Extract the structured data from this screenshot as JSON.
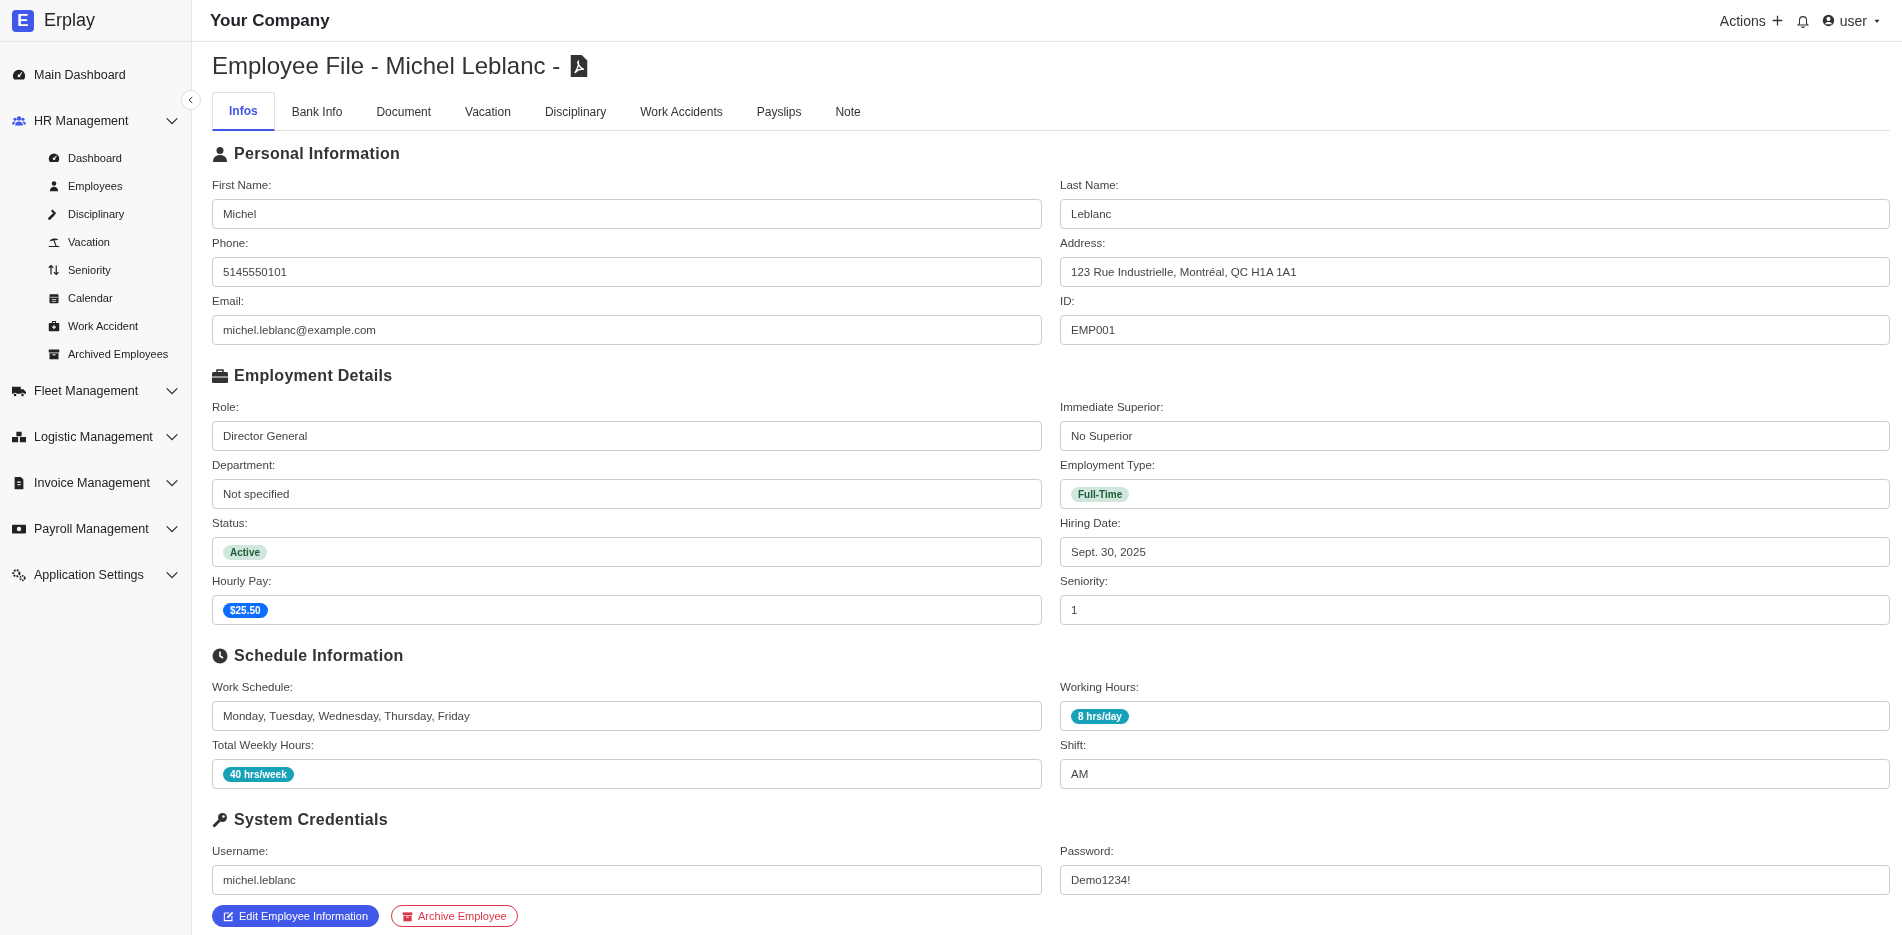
{
  "brand": {
    "logo_letter": "E",
    "name": "Erplay"
  },
  "topbar": {
    "company": "Your Company",
    "actions": "Actions",
    "user": "user"
  },
  "sidebar": {
    "items": [
      {
        "label": "Main Dashboard",
        "selected": false,
        "kind": "link"
      },
      {
        "label": "HR Management",
        "selected": true,
        "kind": "group",
        "children": [
          {
            "label": "Dashboard"
          },
          {
            "label": "Employees"
          },
          {
            "label": "Disciplinary"
          },
          {
            "label": "Vacation"
          },
          {
            "label": "Seniority"
          },
          {
            "label": "Calendar"
          },
          {
            "label": "Work Accident"
          },
          {
            "label": "Archived Employees"
          }
        ]
      },
      {
        "label": "Fleet Management",
        "selected": false,
        "kind": "group"
      },
      {
        "label": "Logistic Management",
        "selected": false,
        "kind": "group"
      },
      {
        "label": "Invoice Management",
        "selected": false,
        "kind": "group"
      },
      {
        "label": "Payroll Management",
        "selected": false,
        "kind": "group"
      },
      {
        "label": "Application Settings",
        "selected": false,
        "kind": "group"
      }
    ]
  },
  "page_title": "Employee File - Michel Leblanc -",
  "tabs": [
    {
      "label": "Infos",
      "selected": true
    },
    {
      "label": "Bank Info",
      "selected": false
    },
    {
      "label": "Document",
      "selected": false
    },
    {
      "label": "Vacation",
      "selected": false
    },
    {
      "label": "Disciplinary",
      "selected": false
    },
    {
      "label": "Work Accidents",
      "selected": false
    },
    {
      "label": "Payslips",
      "selected": false
    },
    {
      "label": "Note",
      "selected": false
    }
  ],
  "sections": [
    {
      "title": "Personal Information",
      "fields": [
        {
          "label": "First Name:",
          "value": "Michel",
          "kind": "text"
        },
        {
          "label": "Last Name:",
          "value": "Leblanc",
          "kind": "text"
        },
        {
          "label": "Phone:",
          "value": "5145550101",
          "kind": "text"
        },
        {
          "label": "Address:",
          "value": "123 Rue Industrielle, Montréal, QC H1A 1A1",
          "kind": "text"
        },
        {
          "label": "Email:",
          "value": "michel.leblanc@example.com",
          "kind": "text"
        },
        {
          "label": "ID:",
          "value": "EMP001",
          "kind": "text"
        }
      ]
    },
    {
      "title": "Employment Details",
      "fields": [
        {
          "label": "Role:",
          "value": "Director General",
          "kind": "text"
        },
        {
          "label": "Immediate Superior:",
          "value": "No Superior",
          "kind": "text"
        },
        {
          "label": "Department:",
          "value": "Not specified",
          "kind": "text"
        },
        {
          "label": "Employment Type:",
          "value": "Full-Time",
          "kind": "success"
        },
        {
          "label": "Status:",
          "value": "Active",
          "kind": "success"
        },
        {
          "label": "Hiring Date:",
          "value": "Sept. 30, 2025",
          "kind": "text"
        },
        {
          "label": "Hourly Pay:",
          "value": "$25.50",
          "kind": "primary"
        },
        {
          "label": "Seniority:",
          "value": "1",
          "kind": "text"
        }
      ]
    },
    {
      "title": "Schedule Information",
      "fields": [
        {
          "label": "Work Schedule:",
          "value": "Monday, Tuesday, Wednesday, Thursday, Friday",
          "kind": "text"
        },
        {
          "label": "Working Hours:",
          "value": "8 hrs/day",
          "kind": "info"
        },
        {
          "label": "Total Weekly Hours:",
          "value": "40 hrs/week",
          "kind": "info"
        },
        {
          "label": "Shift:",
          "value": "AM",
          "kind": "text"
        }
      ]
    },
    {
      "title": "System Credentials",
      "fields": [
        {
          "label": "Username:",
          "value": "michel.leblanc",
          "kind": "text"
        },
        {
          "label": "Password:",
          "value": "Demo1234!",
          "kind": "text"
        }
      ]
    }
  ],
  "buttons": [
    {
      "label": "Edit Employee Information",
      "kind": "primary"
    },
    {
      "label": "Archive Employee",
      "kind": "danger"
    }
  ]
}
